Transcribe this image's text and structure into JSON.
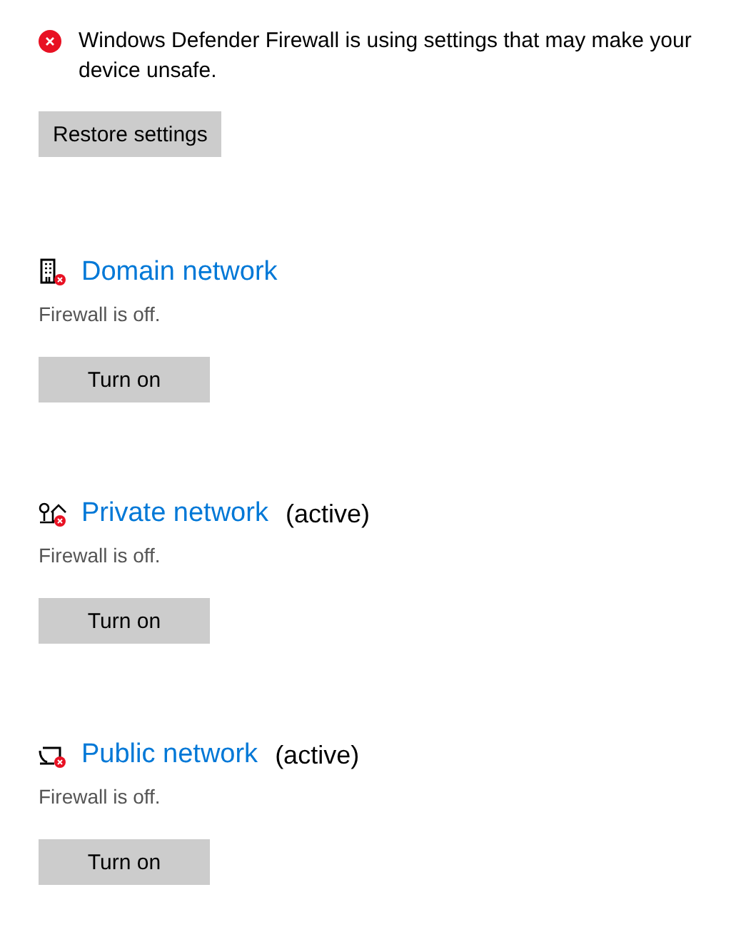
{
  "warning": {
    "text": "Windows Defender Firewall is using settings that may make your device unsafe.",
    "button": "Restore settings"
  },
  "networks": [
    {
      "kind": "domain",
      "title": "Domain network",
      "status": "Firewall is off.",
      "button": "Turn on"
    },
    {
      "kind": "private",
      "title": "Private network",
      "active_label": "(active)",
      "status": "Firewall is off.",
      "button": "Turn on"
    },
    {
      "kind": "public",
      "title": "Public network",
      "active_label": "(active)",
      "status": "Firewall is off.",
      "button": "Turn on"
    }
  ]
}
